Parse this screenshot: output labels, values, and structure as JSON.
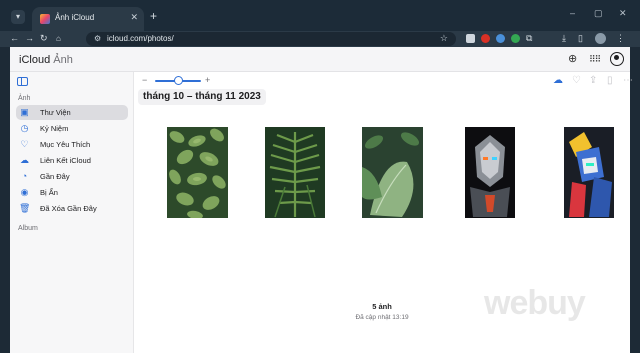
{
  "browser": {
    "tab_title": "Ảnh iCloud",
    "tab_close": "✕",
    "new_tab": "+",
    "url": "icloud.com/photos/",
    "window_controls": [
      "–",
      "▢",
      "✕"
    ]
  },
  "header": {
    "brand_apple": "",
    "brand_icloud": "iCloud",
    "brand_photos": "Ảnh"
  },
  "sidebar": {
    "section_photos": "Ảnh",
    "items": [
      {
        "label": "Thư Viện",
        "icon": "library-icon",
        "active": true
      },
      {
        "label": "Kỷ Niệm",
        "icon": "memories-icon"
      },
      {
        "label": "Mục Yêu Thích",
        "icon": "heart-icon"
      },
      {
        "label": "Liên Kết iCloud",
        "icon": "cloud-link-icon"
      },
      {
        "label": "Gần Đây",
        "icon": "clock-icon"
      },
      {
        "label": "Bị Ẩn",
        "icon": "eye-icon"
      },
      {
        "label": "Đã Xóa Gần Đây",
        "icon": "trash-icon"
      }
    ],
    "section_album": "Album"
  },
  "main": {
    "zoom_minus": "−",
    "zoom_plus": "+",
    "date_range": "tháng 10 – tháng 11 2023",
    "photo_count": "5 ảnh",
    "updated": "Đã cập nhật 13:19"
  },
  "colors": {
    "accent": "#2f6fd6",
    "sidebar_active": "#dcdce0"
  },
  "watermark": "Webuy"
}
